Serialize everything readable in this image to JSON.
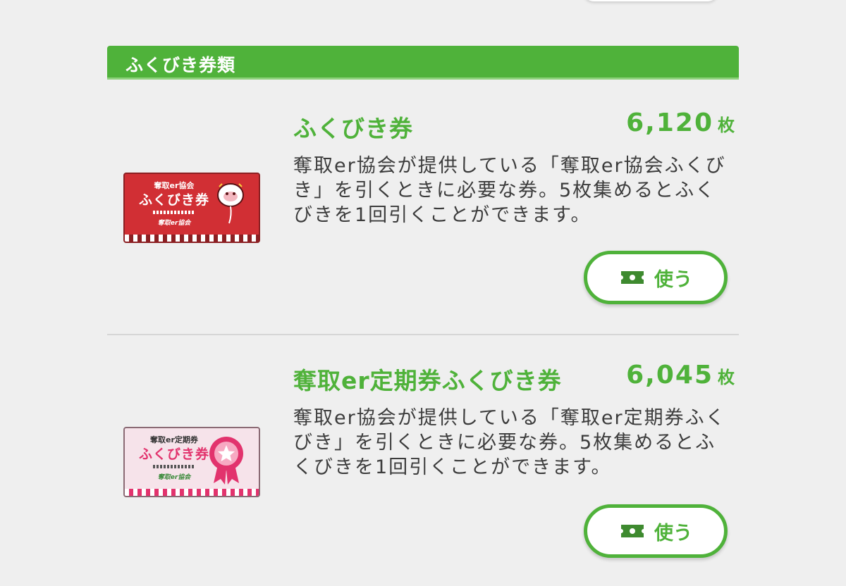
{
  "section": {
    "title": "ふくびき券類"
  },
  "items": [
    {
      "name": "ふくびき券",
      "count": "6,120",
      "unit": "枚",
      "description": "奪取er協会が提供している「奪取er協会ふくびき」を引くときに必要な券。5枚集めるとふくびきを1回引くことができます。",
      "ticket": {
        "header": "奪取er協会",
        "main": "ふくびき券",
        "footer": "奪取er協会"
      },
      "button_label": "使う",
      "colors": {
        "ticket": "#d12f34"
      }
    },
    {
      "name": "奪取er定期券ふくびき券",
      "count": "6,045",
      "unit": "枚",
      "description": "奪取er協会が提供している「奪取er定期券ふくびき」を引くときに必要な券。5枚集めるとふくびきを1回引くことができます。",
      "ticket": {
        "header": "奪取er定期券",
        "main": "ふくびき券",
        "footer": "奪取er協会"
      },
      "button_label": "使う",
      "colors": {
        "ticket": "#f6e3ea"
      }
    }
  ],
  "icons": {
    "button_icon": "ticket-icon",
    "ticket_decoration": "star-badge-icon"
  },
  "colors": {
    "accent": "#4fb23a",
    "background": "#efefef",
    "text": "#3c3c3c"
  }
}
